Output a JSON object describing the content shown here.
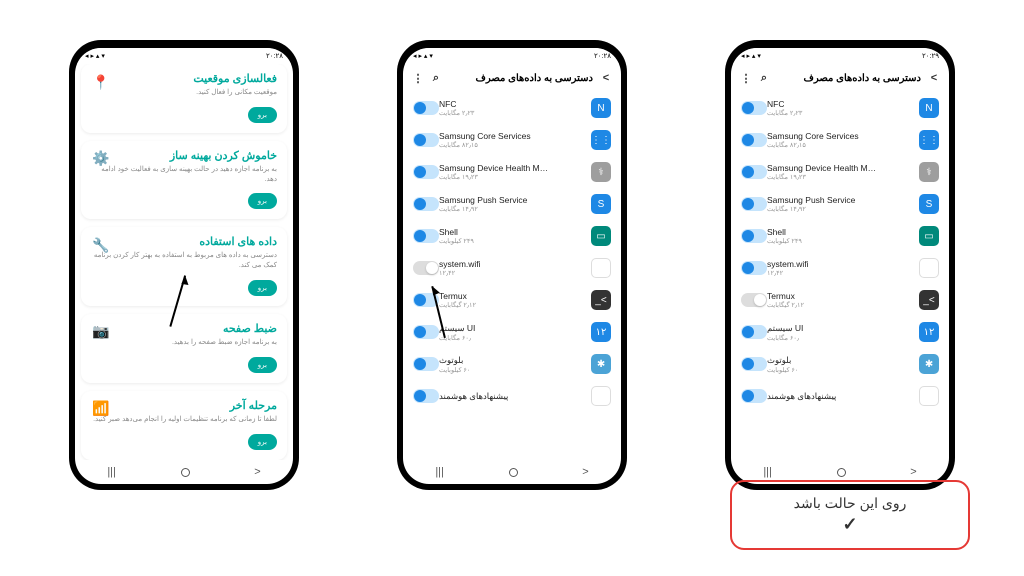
{
  "statusbar": {
    "time_left": "۲۰:۲۸",
    "time_right": "۲۰:۲۹"
  },
  "phone1": {
    "cards": [
      {
        "title": "فعالسازی موقعیت",
        "desc": "موقعیت مکانی را فعال کنید.",
        "btn": "برو",
        "icon": "📍"
      },
      {
        "title": "خاموش کردن بهینه ساز",
        "desc": "به برنامه اجازه دهید در حالت بهینه سازی به فعالیت خود ادامه دهد.",
        "btn": "برو",
        "icon": "⚙️"
      },
      {
        "title": "داده های استفاده",
        "desc": "دسترسی به داده های مربوط به استفاده به بهتر کار کردن برنامه کمک می کند.",
        "btn": "برو",
        "icon": "🔧"
      },
      {
        "title": "ضبط صفحه",
        "desc": "به برنامه اجازه ضبط صفحه را بدهید.",
        "btn": "برو",
        "icon": "📷"
      },
      {
        "title": "مرحله آخر",
        "desc": "لطفا تا زمانی که برنامه تنظیمات اولیه را انجام می‌دهد صبر کنید.",
        "btn": "برو",
        "icon": "📶"
      }
    ]
  },
  "dataAccess": {
    "title": "دسترسی به داده‌های مصرف",
    "apps": [
      {
        "name": "NFC",
        "sub": "۲٫۲۳ مگابایت",
        "toggle": true,
        "color": "bg-blue",
        "glyph": "N"
      },
      {
        "name": "Samsung Core Services",
        "sub": "۸۲٫۱۵ مگابایت",
        "toggle": true,
        "color": "bg-blue",
        "glyph": "⋮⋮"
      },
      {
        "name": "Samsung Device Health Mana..",
        "sub": "۱۹٫۲۳ مگابایت",
        "toggle": true,
        "color": "bg-grey",
        "glyph": "⚕"
      },
      {
        "name": "Samsung Push Service",
        "sub": "۱۴٫۹۲ مگابایت",
        "toggle": true,
        "color": "bg-blue",
        "glyph": "S"
      },
      {
        "name": "Shell",
        "sub": "۲۴۹ کیلوبایت",
        "toggle": true,
        "color": "bg-teal",
        "glyph": "▭"
      },
      {
        "name": "system.wifi",
        "sub": "۱۲٫۴۲",
        "toggle": false,
        "color": "bg-white",
        "glyph": "✲"
      },
      {
        "name": "Termux",
        "sub": "۲٫۱۲ گیگابایت",
        "toggle": true,
        "color": "bg-dark",
        "glyph": ">_"
      },
      {
        "name": "سیستم UI",
        "sub": "۶۰٫ مگابایت",
        "toggle": true,
        "color": "bg-blue",
        "glyph": "۱۲"
      },
      {
        "name": "بلوتوث",
        "sub": "۶۰ کیلوبایت",
        "toggle": true,
        "color": "bg-blueg",
        "glyph": "✱"
      },
      {
        "name": "پیشنهادهای هوشمند",
        "sub": "",
        "toggle": true,
        "color": "bg-white",
        "glyph": "◈"
      }
    ],
    "apps3": [
      {
        "name": "NFC",
        "sub": "۲٫۲۳ مگابایت",
        "toggle": true,
        "color": "bg-blue",
        "glyph": "N"
      },
      {
        "name": "Samsung Core Services",
        "sub": "۸۲٫۱۵ مگابایت",
        "toggle": true,
        "color": "bg-blue",
        "glyph": "⋮⋮"
      },
      {
        "name": "Samsung Device Health Mana..",
        "sub": "۱۹٫۲۳ مگابایت",
        "toggle": true,
        "color": "bg-grey",
        "glyph": "⚕"
      },
      {
        "name": "Samsung Push Service",
        "sub": "۱۴٫۹۲ مگابایت",
        "toggle": true,
        "color": "bg-blue",
        "glyph": "S"
      },
      {
        "name": "Shell",
        "sub": "۲۴۹ کیلوبایت",
        "toggle": true,
        "color": "bg-teal",
        "glyph": "▭"
      },
      {
        "name": "system.wifi",
        "sub": "۱۲٫۴۲",
        "toggle": true,
        "color": "bg-white",
        "glyph": "✲"
      },
      {
        "name": "Termux",
        "sub": "۲٫۱۲ گیگابایت",
        "toggle": false,
        "color": "bg-dark",
        "glyph": ">_"
      },
      {
        "name": "سیستم UI",
        "sub": "۶۰٫ مگابایت",
        "toggle": true,
        "color": "bg-blue",
        "glyph": "۱۲"
      },
      {
        "name": "بلوتوث",
        "sub": "۶۰ کیلوبایت",
        "toggle": true,
        "color": "bg-blueg",
        "glyph": "✱"
      },
      {
        "name": "پیشنهادهای هوشمند",
        "sub": "",
        "toggle": true,
        "color": "bg-white",
        "glyph": "◈"
      }
    ]
  },
  "callout": {
    "text": "روی این حالت باشد",
    "check": "✓"
  }
}
